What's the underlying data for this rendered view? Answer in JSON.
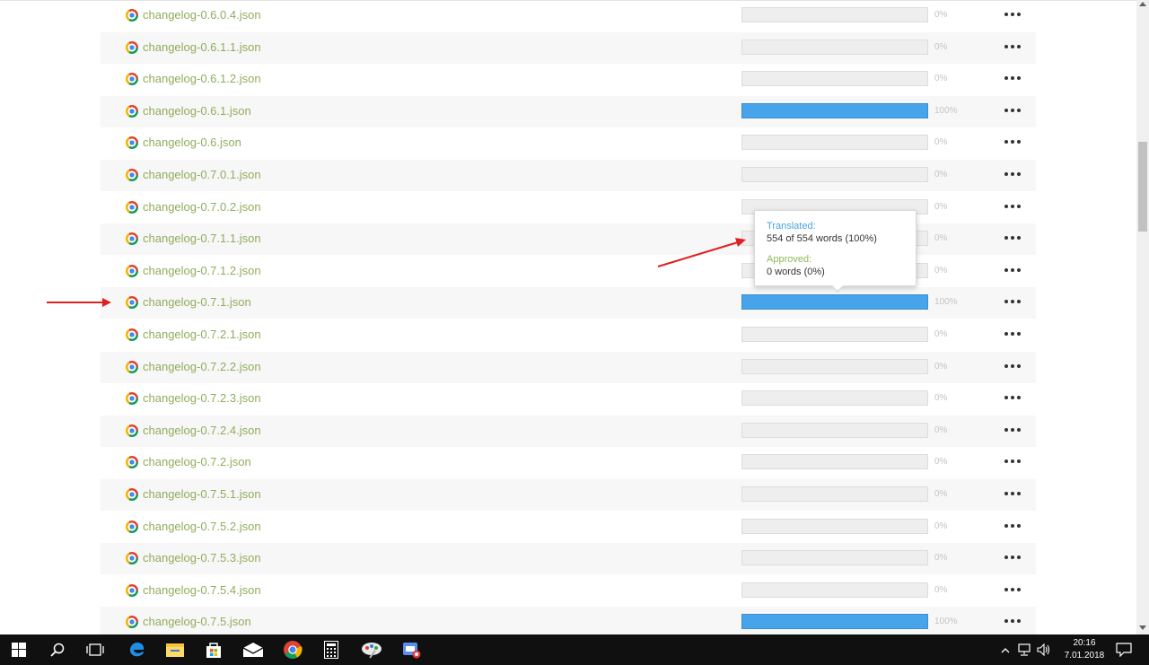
{
  "files": [
    {
      "name": "changelog-0.6.0.4.json",
      "percent": 0,
      "percent_label": "0%"
    },
    {
      "name": "changelog-0.6.1.1.json",
      "percent": 0,
      "percent_label": "0%"
    },
    {
      "name": "changelog-0.6.1.2.json",
      "percent": 0,
      "percent_label": "0%"
    },
    {
      "name": "changelog-0.6.1.json",
      "percent": 100,
      "percent_label": "100%"
    },
    {
      "name": "changelog-0.6.json",
      "percent": 0,
      "percent_label": "0%"
    },
    {
      "name": "changelog-0.7.0.1.json",
      "percent": 0,
      "percent_label": "0%"
    },
    {
      "name": "changelog-0.7.0.2.json",
      "percent": 0,
      "percent_label": "0%"
    },
    {
      "name": "changelog-0.7.1.1.json",
      "percent": 0,
      "percent_label": "0%"
    },
    {
      "name": "changelog-0.7.1.2.json",
      "percent": 0,
      "percent_label": "0%"
    },
    {
      "name": "changelog-0.7.1.json",
      "percent": 100,
      "percent_label": "100%"
    },
    {
      "name": "changelog-0.7.2.1.json",
      "percent": 0,
      "percent_label": "0%"
    },
    {
      "name": "changelog-0.7.2.2.json",
      "percent": 0,
      "percent_label": "0%"
    },
    {
      "name": "changelog-0.7.2.3.json",
      "percent": 0,
      "percent_label": "0%"
    },
    {
      "name": "changelog-0.7.2.4.json",
      "percent": 0,
      "percent_label": "0%"
    },
    {
      "name": "changelog-0.7.2.json",
      "percent": 0,
      "percent_label": "0%"
    },
    {
      "name": "changelog-0.7.5.1.json",
      "percent": 0,
      "percent_label": "0%"
    },
    {
      "name": "changelog-0.7.5.2.json",
      "percent": 0,
      "percent_label": "0%"
    },
    {
      "name": "changelog-0.7.5.3.json",
      "percent": 0,
      "percent_label": "0%"
    },
    {
      "name": "changelog-0.7.5.4.json",
      "percent": 0,
      "percent_label": "0%"
    },
    {
      "name": "changelog-0.7.5.json",
      "percent": 100,
      "percent_label": "100%"
    }
  ],
  "tooltip": {
    "translated_label": "Translated:",
    "translated_value": "554 of 554 words (100%)",
    "approved_label": "Approved:",
    "approved_value": "0 words (0%)"
  },
  "colors": {
    "file_link": "#8fad5d",
    "progress_fill": "#47a3ea",
    "translated_label": "#4aa3df",
    "approved_label": "#8fb85a",
    "annotation_arrow": "#e02020"
  },
  "taskbar": {
    "icons": [
      "windows-start-icon",
      "search-icon",
      "task-view-icon",
      "edge-browser-icon",
      "file-explorer-icon",
      "store-icon",
      "mail-icon",
      "chrome-icon",
      "calculator-icon",
      "paint-icon",
      "app-icon"
    ],
    "tray_icons": [
      "chevron-up-icon",
      "network-icon",
      "volume-icon",
      "notification-icon"
    ],
    "time": "20:16",
    "date": "7.01.2018"
  }
}
